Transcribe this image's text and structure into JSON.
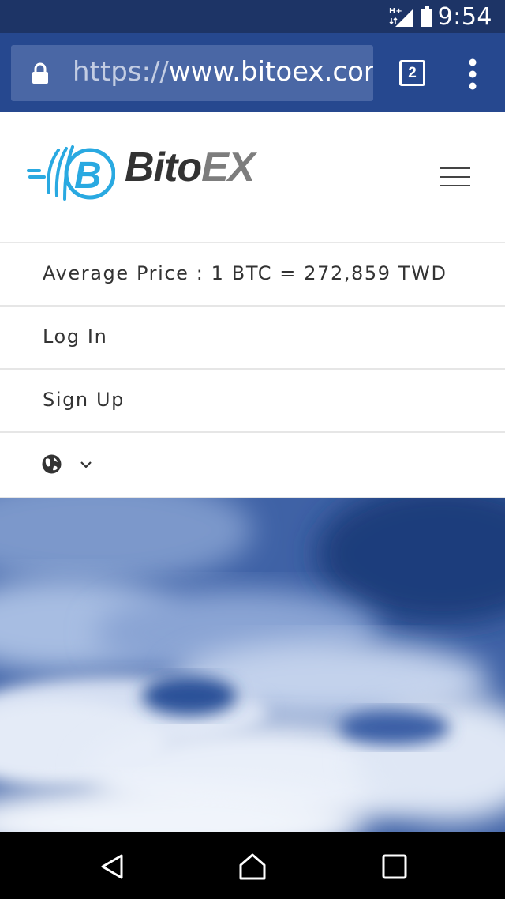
{
  "status_bar": {
    "network_label": "H+",
    "time": "9:54"
  },
  "browser": {
    "url_scheme": "https://",
    "url_host": "www.bitoex.com",
    "tab_count": "2"
  },
  "header": {
    "logo_part1": "Bito",
    "logo_part2": "EX",
    "brand_color": "#29a9e1"
  },
  "menu": {
    "average_price": "Average Price : 1 BTC = 272,859 TWD",
    "login_label": "Log In",
    "signup_label": "Sign Up"
  },
  "icons": {
    "lock": "lock-icon",
    "tabs": "tabs-icon",
    "overflow": "overflow-menu-icon",
    "hamburger": "hamburger-menu-icon",
    "globe": "globe-icon",
    "chevron": "chevron-down-icon",
    "back": "back-icon",
    "home": "home-icon",
    "recents": "recents-icon"
  }
}
